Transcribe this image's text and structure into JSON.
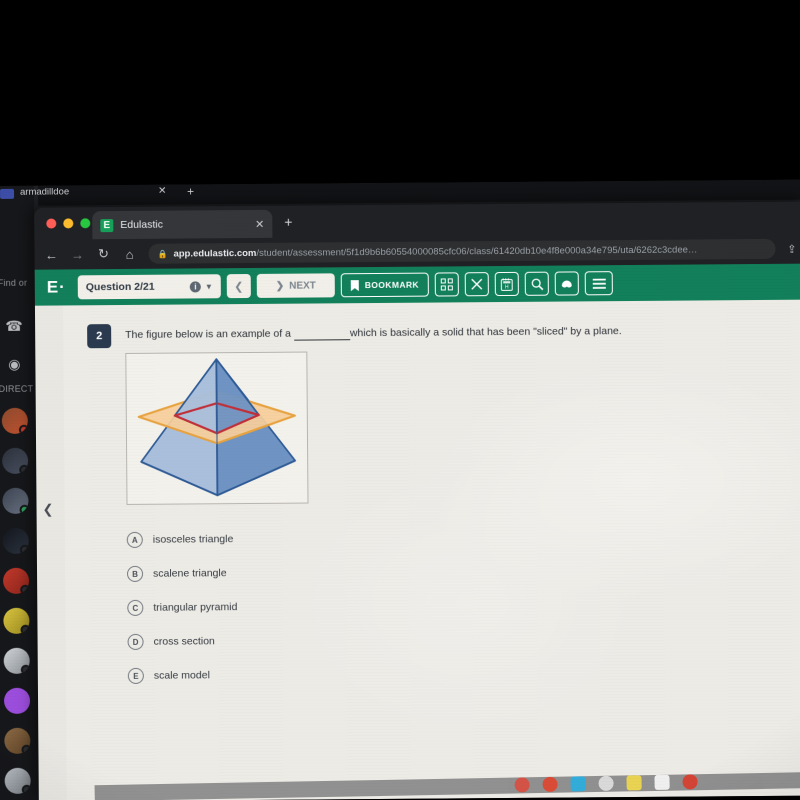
{
  "outer_window": {
    "tab_title": "armadilldoe",
    "tab_close_icon": "close-icon",
    "new_tab_icon": "plus-icon"
  },
  "discord_sidebar": {
    "find_label": "Find or",
    "direct_messages_label": "DIRECT",
    "phone_icon": "phone-icon",
    "eye_icon": "eye-icon",
    "avatar_count": 12
  },
  "browser": {
    "traffic_lights": [
      "#ff5f57",
      "#febc2e",
      "#28c840"
    ],
    "tab": {
      "favicon_letter": "E",
      "title": "Edulastic",
      "close_icon": "close-icon"
    },
    "new_tab_icon": "plus-icon",
    "nav": {
      "back_icon": "arrow-left-icon",
      "forward_icon": "arrow-right-icon",
      "reload_icon": "reload-icon",
      "home_icon": "home-icon"
    },
    "address_bar": {
      "lock_icon": "lock-icon",
      "url_domain": "app.edulastic.com",
      "url_path": "/student/assessment/5f1d9b6b60554000085cfc06/class/61420db10e4f8e000a34e795/uta/6262c3cdee…",
      "share_icon": "share-icon"
    }
  },
  "app_header": {
    "brand": "E·",
    "brand_color": "#ffffff",
    "header_color": "#12805a",
    "question_pill": {
      "label": "Question 2/21",
      "info_icon": "info-icon",
      "caret_icon": "chevron-down-icon"
    },
    "prev_button": {
      "label": "‹",
      "icon": "chevron-left-icon"
    },
    "next_button": {
      "label": "NEXT",
      "icon": "chevron-right-icon"
    },
    "bookmark_button": {
      "label": "BOOKMARK",
      "icon": "bookmark-icon"
    },
    "tools": [
      {
        "name": "apps-grid-icon",
        "glyph": "⌸"
      },
      {
        "name": "close-x-icon",
        "glyph": "✕"
      },
      {
        "name": "calculator-icon",
        "glyph": "὚9"
      },
      {
        "name": "magnifier-icon",
        "glyph": "ὐD"
      },
      {
        "name": "mask-icon",
        "glyph": "◖"
      },
      {
        "name": "hamburger-menu-icon",
        "glyph": "☰"
      }
    ]
  },
  "question": {
    "number": "2",
    "number_badge_color": "#2b3a4e",
    "text_before_blank": "The figure below is an example of a",
    "blank_1": "",
    "blank_2": "",
    "text_after_blank": "which is basically a solid that has been  \"sliced\" by a plane.",
    "collapse_icon": "chevron-left-icon",
    "figure": {
      "name": "square-pyramid-cross-section-diagram",
      "description": "Blue square pyramid intersected by an orange horizontal plane with a red square cross-section outline",
      "pyramid_fill_left": "#a8bcd9",
      "pyramid_fill_right": "#6e93c2",
      "pyramid_stroke": "#2f5b96",
      "plane_fill": "#f8d09a",
      "plane_stroke": "#e8a33d",
      "cross_section_stroke": "#c0303a",
      "hidden_edge_stroke": "#7a86b8"
    },
    "choices": [
      {
        "letter": "A",
        "text": "isosceles triangle"
      },
      {
        "letter": "B",
        "text": "scalene triangle"
      },
      {
        "letter": "C",
        "text": "triangular pyramid"
      },
      {
        "letter": "D",
        "text": "cross section"
      },
      {
        "letter": "E",
        "text": "scale model"
      }
    ]
  },
  "dock": {
    "icon_colors": [
      "#d34b3f",
      "#d8442e",
      "#2aa9d8",
      "#d9d9d9",
      "#e8d24a",
      "#f0f0f0",
      "#d33b2c"
    ]
  }
}
